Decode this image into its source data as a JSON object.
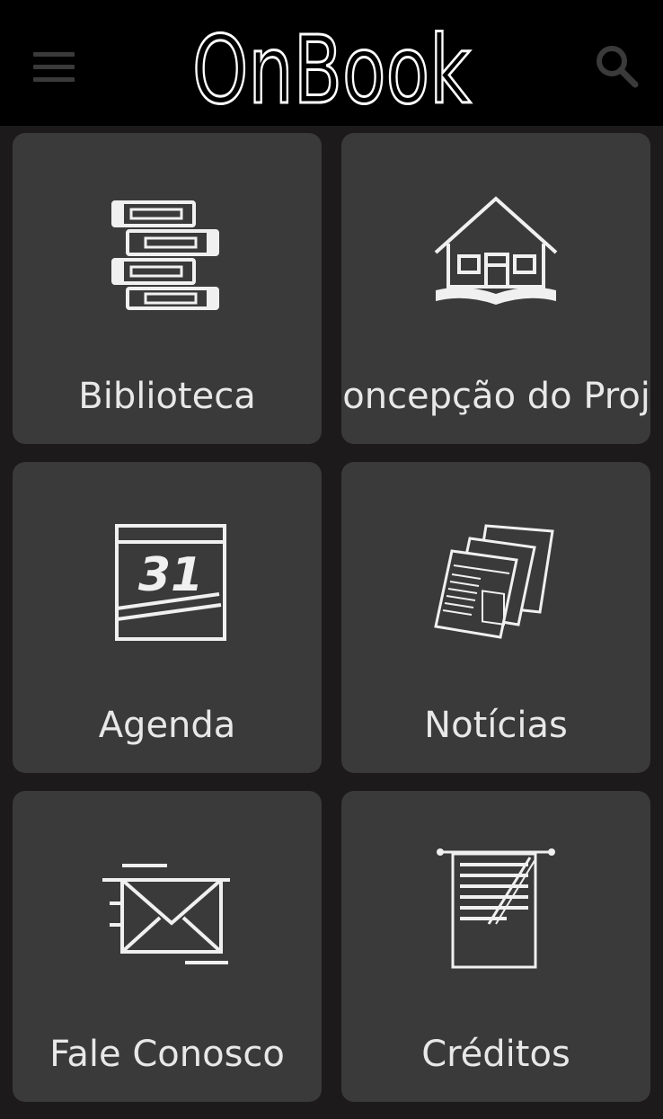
{
  "appbar": {
    "title": "OnBook",
    "menu_icon": "hamburger-menu-icon",
    "search_icon": "search-icon"
  },
  "tiles": [
    {
      "label": "Biblioteca",
      "icon": "books-stack-icon"
    },
    {
      "label": "Concepção do Projeto",
      "icon": "house-on-book-icon"
    },
    {
      "label": "Agenda",
      "icon": "calendar-31-icon"
    },
    {
      "label": "Notícias",
      "icon": "newspapers-icon"
    },
    {
      "label": "Fale Conosco",
      "icon": "envelope-icon"
    },
    {
      "label": "Créditos",
      "icon": "credits-scroll-icon"
    }
  ],
  "colors": {
    "appbar_bg": "#000000",
    "background": "#1c1a1a",
    "tile_bg": "#3a3a3a",
    "text": "#e8e8e8"
  }
}
